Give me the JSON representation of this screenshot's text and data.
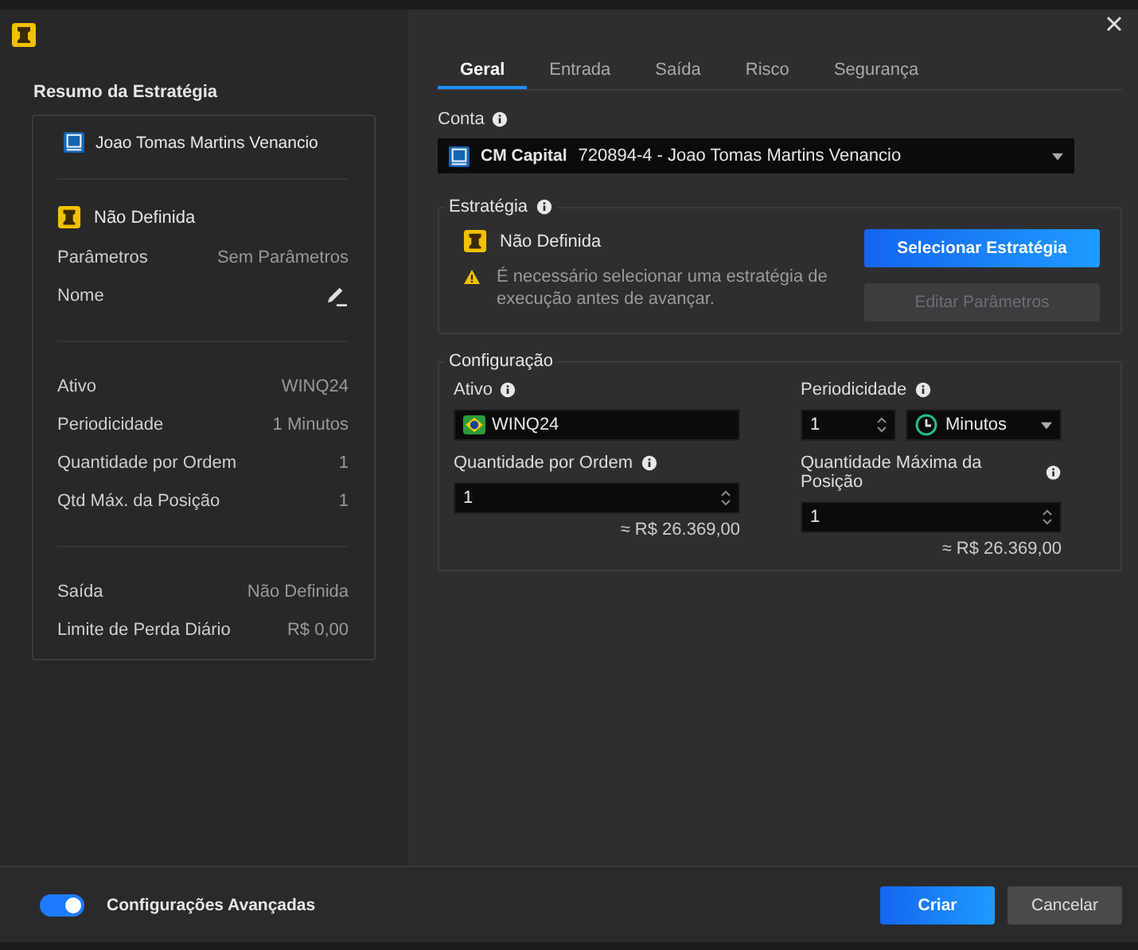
{
  "sidebar": {
    "title": "Resumo da Estratégia",
    "account": "Joao Tomas Martins Venancio",
    "strategy": "Não Definida",
    "groups": [
      [
        {
          "kind": "text",
          "label": "Parâmetros",
          "value": "Sem Parâmetros"
        },
        {
          "kind": "edit",
          "label": "Nome"
        }
      ],
      [
        {
          "kind": "text",
          "label": "Ativo",
          "value": "WINQ24"
        },
        {
          "kind": "text",
          "label": "Periodicidade",
          "value": "1 Minutos"
        },
        {
          "kind": "text",
          "label": "Quantidade por Ordem",
          "value": "1"
        },
        {
          "kind": "text",
          "label": "Qtd Máx. da Posição",
          "value": "1"
        }
      ],
      [
        {
          "kind": "text",
          "label": "Saída",
          "value": "Não Definida"
        },
        {
          "kind": "text",
          "label": "Limite de Perda Diário",
          "value": "R$ 0,00"
        }
      ]
    ]
  },
  "tabs": [
    {
      "label": "Geral",
      "selected": true
    },
    {
      "label": "Entrada",
      "selected": false
    },
    {
      "label": "Saída",
      "selected": false
    },
    {
      "label": "Risco",
      "selected": false
    },
    {
      "label": "Segurança",
      "selected": false
    }
  ],
  "conta": {
    "label": "Conta",
    "broker": "CM Capital",
    "account": "720894-4 - Joao Tomas Martins Venancio"
  },
  "estrategia": {
    "title": "Estratégia",
    "name": "Não Definida",
    "warning": "É necessário selecionar uma estratégia de execução antes de avançar.",
    "buttons": [
      {
        "label": "Selecionar Estratégia",
        "disabled": false
      },
      {
        "label": "Editar Parâmetros",
        "disabled": true
      }
    ]
  },
  "configuracao": {
    "title": "Configuração",
    "ativo": {
      "label": "Ativo",
      "value": "WINQ24"
    },
    "periodicidade": {
      "label": "Periodicidade",
      "value": "1",
      "unit": "Minutos"
    },
    "quantidade_por_ordem": {
      "label": "Quantidade por Ordem",
      "value": "1",
      "estimate": "≈ R$ 26.369,00"
    },
    "quantidade_maxima": {
      "label": "Quantidade Máxima da Posição",
      "value": "1",
      "estimate": "≈ R$ 26.369,00"
    }
  },
  "footer": {
    "advanced": {
      "label": "Configurações Avançadas",
      "on": true
    },
    "buttons": [
      {
        "label": "Criar",
        "kind": "primary"
      },
      {
        "label": "Cancelar",
        "kind": "secondary"
      }
    ]
  }
}
